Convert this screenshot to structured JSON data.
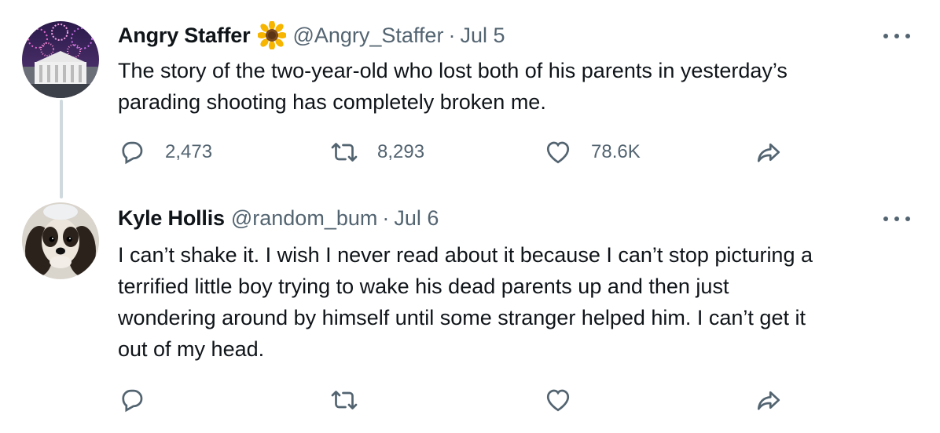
{
  "tweets": [
    {
      "name": "Angry Staffer",
      "emoji": "sunflower-icon",
      "handle": "@Angry_Staffer",
      "separator": "·",
      "date": "Jul 5",
      "text": "The story of the two-year-old who lost both of his parents in yesterday’s\nparading shooting has completely broken me.",
      "replies": "2,473",
      "retweets": "8,293",
      "likes": "78.6K"
    },
    {
      "name": "Kyle Hollis",
      "handle": "@random_bum",
      "separator": "·",
      "date": "Jul 6",
      "text": "I can’t shake it. I wish I never read about it because I can’t stop picturing a\nterrified little boy trying to wake his dead parents up and then just\nwondering around by himself until some stranger helped him. I can’t get it\nout of my head.",
      "replies": "",
      "retweets": "",
      "likes": ""
    }
  ],
  "colors": {
    "text": "#0f1419",
    "muted": "#536471",
    "thread_line": "#cfd9de"
  }
}
